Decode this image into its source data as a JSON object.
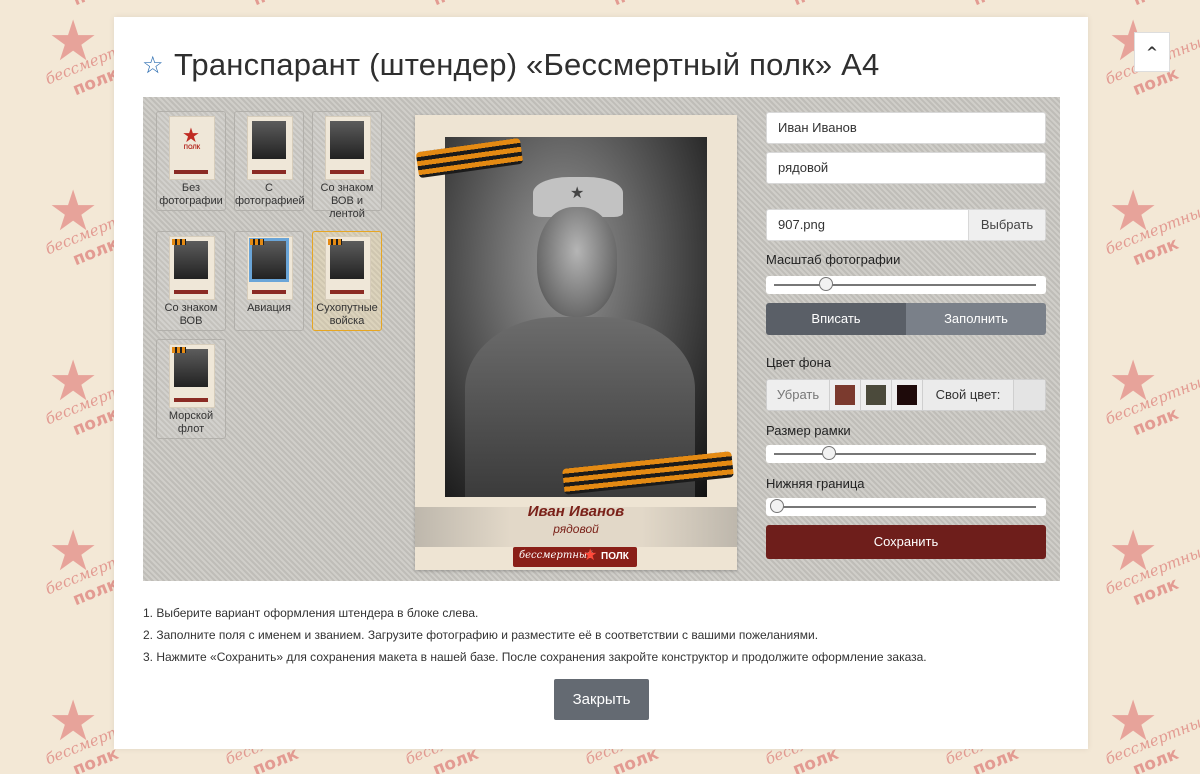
{
  "background": {
    "tile_line1": "бессмертный",
    "tile_line2": "полк",
    "tile_color": "#e39b92"
  },
  "modal": {
    "title": "Транспарант (штендер) «Бессмертный полк» А4",
    "favorite_icon": "star-outline-icon"
  },
  "templates": [
    {
      "label": "Без фотографии",
      "selected": false
    },
    {
      "label": "С фотографией",
      "selected": false
    },
    {
      "label": "Со знаком ВОВ и лентой",
      "selected": false
    },
    {
      "label": "Со знаком ВОВ",
      "selected": false
    },
    {
      "label": "Авиация",
      "selected": false
    },
    {
      "label": "Сухопутные войска",
      "selected": true
    },
    {
      "label": "Морской флот",
      "selected": false
    }
  ],
  "preview": {
    "name": "Иван Иванов",
    "rank": "рядовой",
    "logo_word1": "бессмертный",
    "logo_word2": "ПОЛК"
  },
  "form": {
    "name_value": "Иван Иванов",
    "rank_value": "рядовой",
    "file_name": "907.png",
    "choose_label": "Выбрать",
    "photo_scale_label": "Масштаб фотографии",
    "photo_scale_fraction": 0.19,
    "fit_label": "Вписать",
    "fill_label": "Заполнить",
    "bg_color_label": "Цвет фона",
    "remove_label": "Убрать",
    "swatches": [
      "#7b3a2e",
      "#4b4a3b",
      "#1e0a0a"
    ],
    "own_color_label": "Свой цвет:",
    "frame_size_label": "Размер рамки",
    "frame_size_fraction": 0.2,
    "bottom_border_label": "Нижняя граница",
    "bottom_border_fraction": 0.0,
    "save_label": "Сохранить"
  },
  "instructions": [
    "1. Выберите вариант оформления штендера в блоке слева.",
    "2. Заполните поля с именем и званием. Загрузите фотографию и разместите её в соответствии с вашими пожеланиями.",
    "3. Нажмите «Сохранить» для сохранения макета в нашей базе. После сохранения закройте конструктор и продолжите оформление заказа."
  ],
  "close_label": "Закрыть",
  "scroll_top_icon": "chevron-up-icon"
}
